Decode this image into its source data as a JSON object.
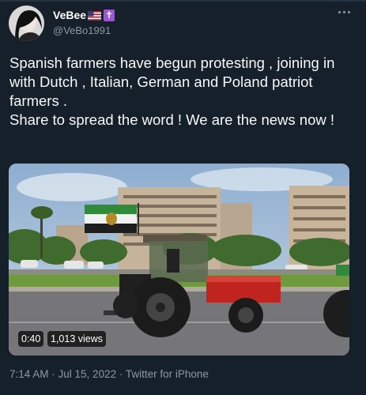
{
  "user": {
    "display_name": "VeBee",
    "flag_icon": "us-flag-icon",
    "badge_icon": "latin-cross-icon",
    "badge_glyph": "✝",
    "handle": "@VeBo1991"
  },
  "tweet": {
    "text": "Spanish farmers have begun protesting , joining in with Dutch , Italian, German and Poland patriot farmers .\nShare to spread the word ! We are the news now !"
  },
  "video": {
    "duration": "0:40",
    "views": "1,013 views"
  },
  "meta": {
    "time": "7:14 AM",
    "separator": " · ",
    "date": "Jul 15, 2022",
    "client": "Twitter for iPhone"
  },
  "colors": {
    "background": "#15202b",
    "secondary_text": "#8b98a5",
    "tractor_red": "#c0241f",
    "flag_green": "#2f8a3a"
  }
}
